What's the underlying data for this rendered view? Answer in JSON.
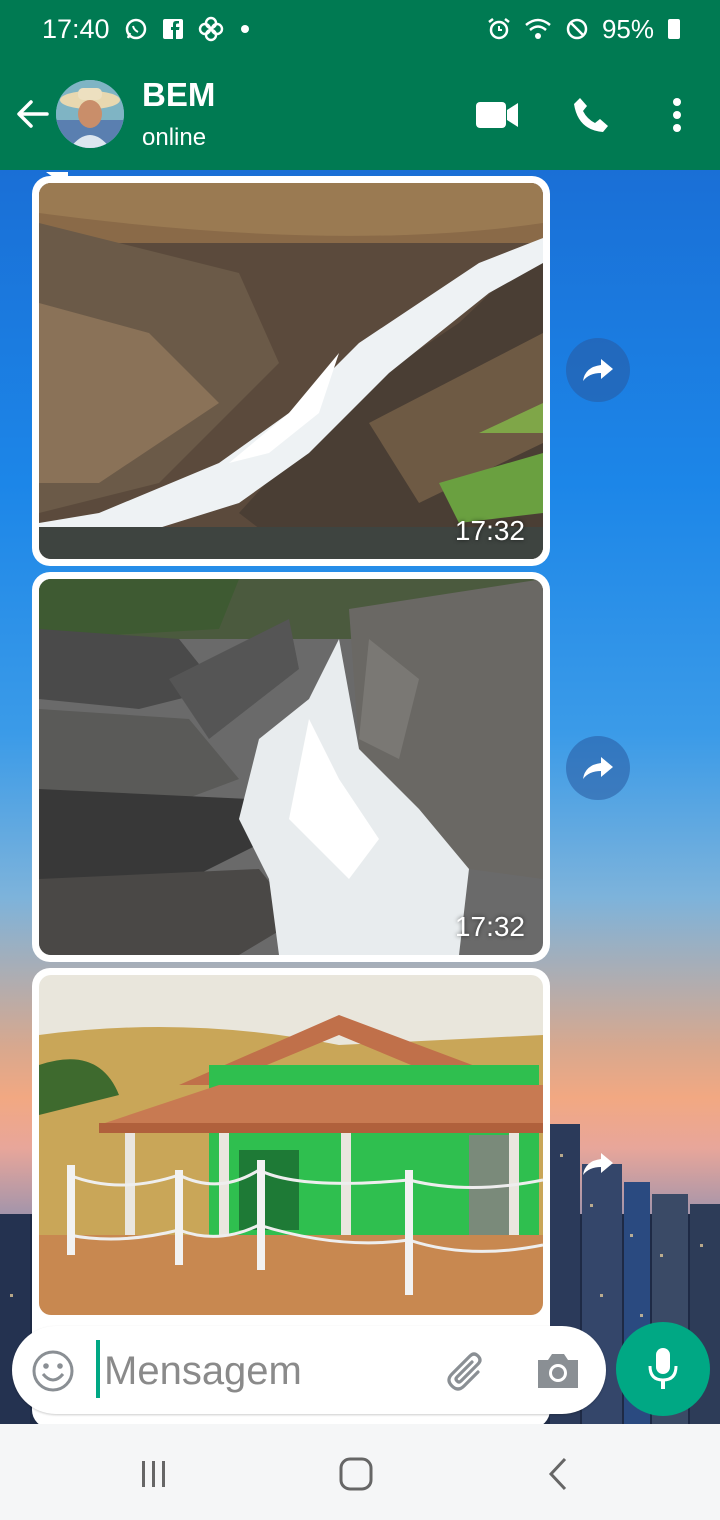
{
  "status_bar": {
    "time": "17:40",
    "battery": "95%",
    "icons": [
      "whatsapp-icon",
      "facebook-icon",
      "pinwheel-icon",
      "dot-icon",
      "alarm-icon",
      "wifi-icon",
      "do-not-disturb-icon",
      "battery-icon"
    ]
  },
  "header": {
    "contact_name": "BEM",
    "contact_status": "online",
    "icons": [
      "back-arrow-icon",
      "video-call-icon",
      "voice-call-icon",
      "more-options-icon"
    ]
  },
  "messages": [
    {
      "type": "image",
      "description_icon": "waterfall-photo",
      "time": "17:32"
    },
    {
      "type": "image",
      "description_icon": "waterfall-photo",
      "time": "17:32"
    },
    {
      "type": "image",
      "description_icon": "green-house-photo",
      "time": ""
    }
  ],
  "input": {
    "placeholder": "Mensagem",
    "icons": [
      "emoji-icon",
      "paperclip-icon",
      "camera-icon",
      "microphone-icon"
    ]
  },
  "colors": {
    "header_green": "#007a52",
    "accent_green": "#00a884"
  }
}
